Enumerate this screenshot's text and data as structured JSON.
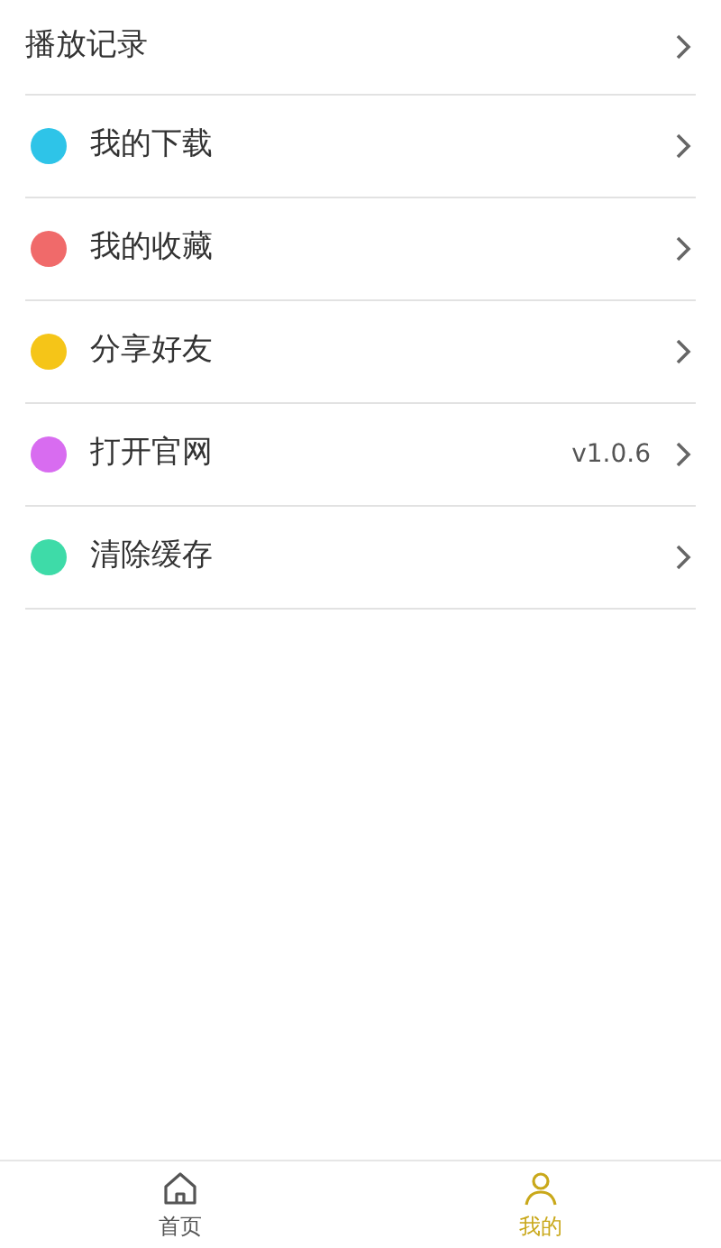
{
  "header_row": {
    "label": "播放记录"
  },
  "menu": [
    {
      "label": "我的下载",
      "color": "#2ec4e8"
    },
    {
      "label": "我的收藏",
      "color": "#f06a6a"
    },
    {
      "label": "分享好友",
      "color": "#f5c518"
    },
    {
      "label": "打开官网",
      "color": "#d86cf0",
      "value": "v1.0.6"
    },
    {
      "label": "清除缓存",
      "color": "#3edba8"
    }
  ],
  "bottom_nav": [
    {
      "label": "首页",
      "selected": false
    },
    {
      "label": "我的",
      "selected": true
    }
  ]
}
